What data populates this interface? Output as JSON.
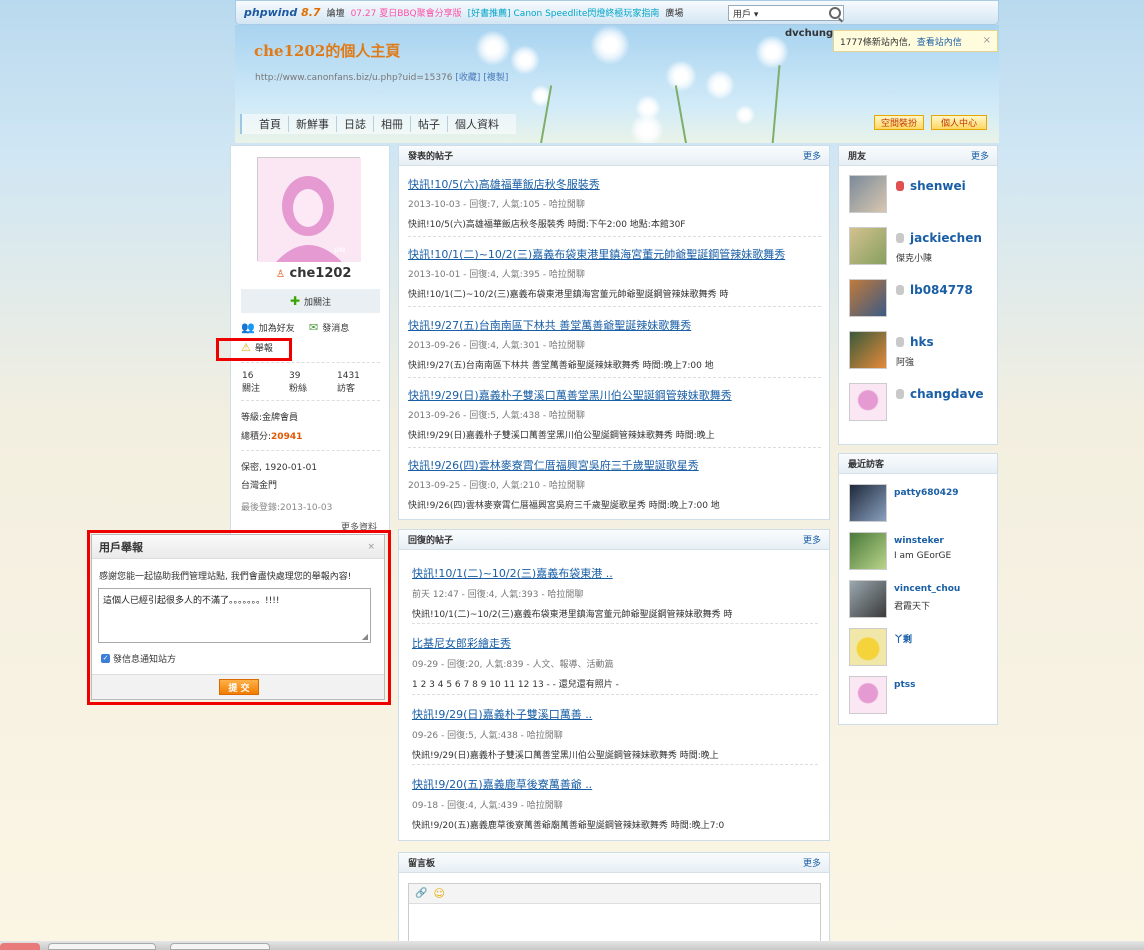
{
  "topbar": {
    "logo": "phpwind",
    "version": "8.7",
    "forum": "論壇",
    "ticker1": "07.27 夏日BBQ聚會分享版",
    "ticker2": "[好書推薦] Canon Speedlite閃燈終極玩家指南",
    "square": "廣場",
    "search_select": "用戶 ▾"
  },
  "header": {
    "title": "che1202的個人主頁",
    "url": "http://www.canonfans.biz/u.php?uid=15376",
    "bookmark": "[收藏]",
    "copy": "[複製]",
    "nav": [
      "首頁",
      "新鮮事",
      "日誌",
      "相冊",
      "帖子",
      "個人資料"
    ],
    "decorate_btn": "空間裝扮",
    "center_btn": "個人中心",
    "user": "dvchung"
  },
  "notice": {
    "text": "1777條新站內信,",
    "link": "查看站內信",
    "close": "×"
  },
  "profile": {
    "username": "che1202",
    "follow": "加關注",
    "add_friend": "加為好友",
    "message": "發消息",
    "report": "舉報",
    "stats": [
      {
        "num": "16",
        "label": "關注"
      },
      {
        "num": "39",
        "label": "粉絲"
      },
      {
        "num": "1431",
        "label": "訪客"
      }
    ],
    "level_label": "等級:",
    "level": "金牌會員",
    "points_label": "總積分:",
    "points": "20941",
    "privacy": "保密,",
    "birthday": "1920-01-01",
    "location": "台灣金門",
    "last_login_label": "最後登錄:",
    "last_login": "2013-10-03",
    "more": "更多資料"
  },
  "posts_panel": {
    "title": "發表的帖子",
    "more": "更多",
    "items": [
      {
        "title": "快訊!10/5(六)高雄福華飯店秋冬服裝秀",
        "meta": "2013-10-03 - 回復:7, 人氣:105 - 哈拉閒聊",
        "desc": "快訊!10/5(六)高雄福華飯店秋冬服裝秀 時間:下午2:00 地點:本館30F"
      },
      {
        "title": "快訊!10/1(二)~10/2(三)嘉義布袋東港里鎮海宮董元帥爺聖誕鋼管辣妹歌舞秀",
        "meta": "2013-10-01 - 回復:4, 人氣:395 - 哈拉閒聊",
        "desc": "快訊!10/1(二)~10/2(三)嘉義布袋東港里鎮海宮董元帥爺聖誕鋼管辣妹歌舞秀 時"
      },
      {
        "title": "快訊!9/27(五)台南南區下林共 善堂萬善爺聖誕辣妹歌舞秀",
        "meta": "2013-09-26 - 回復:4, 人氣:301 - 哈拉閒聊",
        "desc": "快訊!9/27(五)台南南區下林共 善堂萬善爺聖誕辣妹歌舞秀 時間:晚上7:00 地"
      },
      {
        "title": "快訊!9/29(日)嘉義朴子雙溪口萬善堂黑川伯公聖誕鋼管辣妹歌舞秀",
        "meta": "2013-09-26 - 回復:5, 人氣:438 - 哈拉閒聊",
        "desc": "快訊!9/29(日)嘉義朴子雙溪口萬善堂黑川伯公聖誕鋼管辣妹歌舞秀 時間:晚上"
      },
      {
        "title": "快訊!9/26(四)雲林麥寮霄仁厝福興宮吳府三千歲聖誕歌星秀",
        "meta": "2013-09-25 - 回復:0, 人氣:210 - 哈拉閒聊",
        "desc": "快訊!9/26(四)雲林麥寮霄仁厝福興宮吳府三千歲聖誕歌星秀 時間:晚上7:00 地"
      }
    ]
  },
  "replies_panel": {
    "title": "回復的帖子",
    "more": "更多",
    "items": [
      {
        "title": "快訊!10/1(二)~10/2(三)嘉義布袋東港 ..",
        "meta": "前天 12:47 - 回復:4, 人氣:393 - 哈拉閒聊",
        "desc": "快訊!10/1(二)~10/2(三)嘉義布袋東港里鎮海宮董元帥爺聖誕鋼管辣妹歌舞秀 時"
      },
      {
        "title": "比基尼女郎彩繪走秀",
        "meta": "09-29 - 回復:20, 人氣:839 - 人文、報導、活動篇",
        "desc": "1 2 3 4 5 6 7 8 9 10 11 12 13 - - 還兒還有照片 -"
      },
      {
        "title": "快訊!9/29(日)嘉義朴子雙溪口萬善 ..",
        "meta": "09-26 - 回復:5, 人氣:438 - 哈拉閒聊",
        "desc": "快訊!9/29(日)嘉義朴子雙溪口萬善堂黑川伯公聖誕鋼管辣妹歌舞秀 時間:晚上"
      },
      {
        "title": "快訊!9/20(五)嘉義鹿草後寮萬善爺 ..",
        "meta": "09-18 - 回復:4, 人氣:439 - 哈拉閒聊",
        "desc": "快訊!9/20(五)嘉義鹿草後寮萬善爺廟萬善爺聖誕鋼管辣妹歌舞秀 時間:晚上7:0"
      }
    ]
  },
  "guestbook": {
    "title": "留言板",
    "more": "更多"
  },
  "friends_panel": {
    "title": "朋友",
    "more": "更多",
    "items": [
      {
        "name": "shenwei",
        "sub": ""
      },
      {
        "name": "jackiechen",
        "sub": "傑克小陳"
      },
      {
        "name": "lb084778",
        "sub": ""
      },
      {
        "name": "hks",
        "sub": "阿強"
      },
      {
        "name": "changdave",
        "sub": ""
      }
    ]
  },
  "visitors_panel": {
    "title": "最近訪客",
    "items": [
      {
        "name": "patty680429",
        "sub": ""
      },
      {
        "name": "winsteker",
        "sub": "I am GEorGE"
      },
      {
        "name": "vincent_chou",
        "sub": "君霞天下"
      },
      {
        "name": "丫剩",
        "sub": ""
      },
      {
        "name": "ptss",
        "sub": ""
      }
    ]
  },
  "report_dialog": {
    "title": "用戶舉報",
    "close": "×",
    "intro": "感謝您能一起協助我們管理站點, 我們會盡快處理您的舉報內容!",
    "text": "這個人已經引起很多人的不滿了。。。。。。。!!!!",
    "notify_label": "發信息通知站方",
    "submit": "提 交"
  },
  "colors": {
    "accent": "#e07a16",
    "link": "#1a5fa6",
    "highlight": "#e00000",
    "points": "#e05500"
  }
}
